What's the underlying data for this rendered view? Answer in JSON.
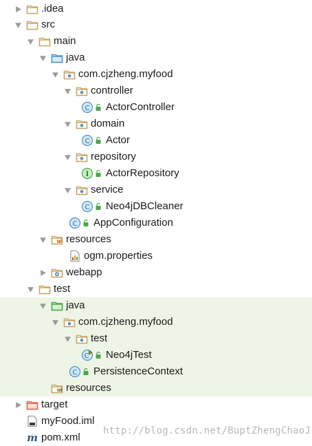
{
  "colors": {
    "folder": "#c8a86a",
    "package_dot": "#5a8fb5",
    "class_circle": "#d1e7f6",
    "class_stroke": "#4b93c9",
    "interface_circle": "#c8efc0",
    "lock": "#4aa84a",
    "test_background": "#eef5e6"
  },
  "tree": [
    {
      "label": ".idea",
      "icon": "folder-icon"
    },
    {
      "label": "src",
      "icon": "folder-icon"
    },
    {
      "label": "main",
      "icon": "folder-icon"
    },
    {
      "label": "java",
      "icon": "source-folder-icon"
    },
    {
      "label": "com.cjzheng.myfood",
      "icon": "package-icon"
    },
    {
      "label": "controller",
      "icon": "package-icon"
    },
    {
      "label": "ActorController",
      "icon": "class-icon"
    },
    {
      "label": "domain",
      "icon": "package-icon"
    },
    {
      "label": "Actor",
      "icon": "class-icon"
    },
    {
      "label": "repository",
      "icon": "package-icon"
    },
    {
      "label": "ActorRepository",
      "icon": "interface-icon"
    },
    {
      "label": "service",
      "icon": "package-icon"
    },
    {
      "label": "Neo4jDBCleaner",
      "icon": "class-icon"
    },
    {
      "label": "AppConfiguration",
      "icon": "class-icon"
    },
    {
      "label": "resources",
      "icon": "resources-folder-icon"
    },
    {
      "label": "ogm.properties",
      "icon": "properties-file-icon"
    },
    {
      "label": "webapp",
      "icon": "web-folder-icon"
    },
    {
      "label": "test",
      "icon": "folder-icon"
    },
    {
      "label": "java",
      "icon": "test-source-folder-icon"
    },
    {
      "label": "com.cjzheng.myfood",
      "icon": "package-icon"
    },
    {
      "label": "test",
      "icon": "package-icon"
    },
    {
      "label": "Neo4jTest",
      "icon": "test-class-icon"
    },
    {
      "label": "PersistenceContext",
      "icon": "class-icon"
    },
    {
      "label": "resources",
      "icon": "resources-folder-icon"
    },
    {
      "label": "target",
      "icon": "excluded-folder-icon"
    },
    {
      "label": "myFood.iml",
      "icon": "iml-file-icon"
    },
    {
      "label": "pom.xml",
      "icon": "maven-file-icon"
    }
  ],
  "watermark": "http://blog.csdn.net/BuptZhengChaoJie"
}
